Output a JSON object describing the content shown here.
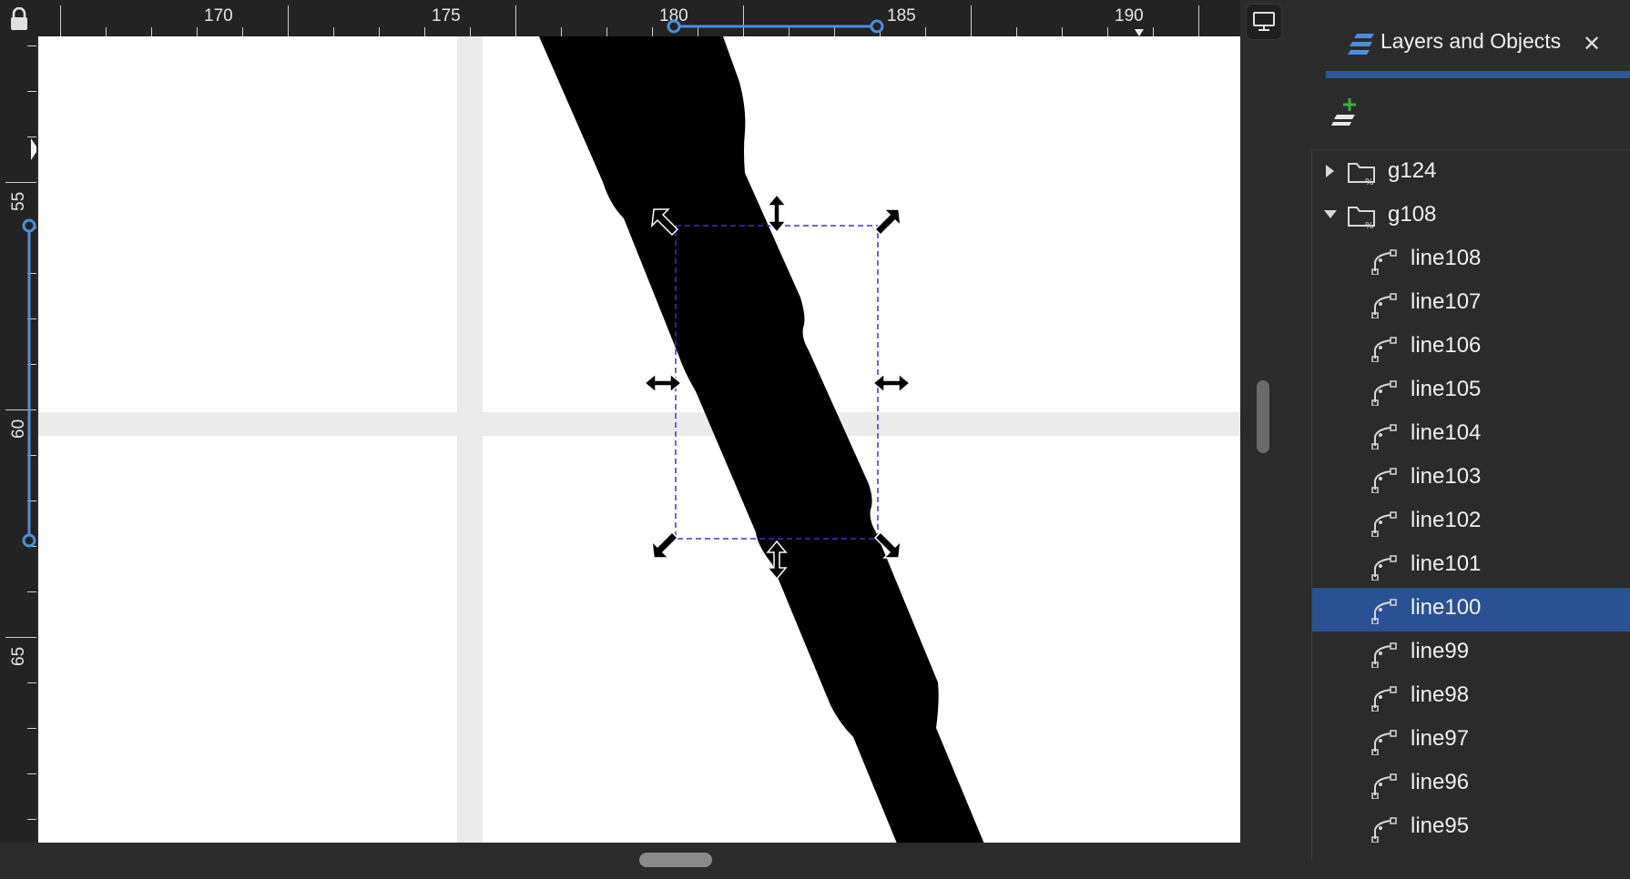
{
  "rulers": {
    "horizontal_labels": [
      "170",
      "175",
      "180",
      "185",
      "190"
    ],
    "vertical_labels": [
      "55",
      "60",
      "65"
    ]
  },
  "panel": {
    "title": "Layers and Objects",
    "close_icon": "close-icon",
    "add_layer_icon": "add-layer-icon",
    "tree": [
      {
        "name": "g124",
        "type": "group",
        "expanded": false,
        "selected": false
      },
      {
        "name": "g108",
        "type": "group",
        "expanded": true,
        "selected": false
      },
      {
        "name": "line108",
        "type": "path",
        "selected": false
      },
      {
        "name": "line107",
        "type": "path",
        "selected": false
      },
      {
        "name": "line106",
        "type": "path",
        "selected": false
      },
      {
        "name": "line105",
        "type": "path",
        "selected": false
      },
      {
        "name": "line104",
        "type": "path",
        "selected": false
      },
      {
        "name": "line103",
        "type": "path",
        "selected": false
      },
      {
        "name": "line102",
        "type": "path",
        "selected": false
      },
      {
        "name": "line101",
        "type": "path",
        "selected": false
      },
      {
        "name": "line100",
        "type": "path",
        "selected": true
      },
      {
        "name": "line99",
        "type": "path",
        "selected": false
      },
      {
        "name": "line98",
        "type": "path",
        "selected": false
      },
      {
        "name": "line97",
        "type": "path",
        "selected": false
      },
      {
        "name": "line96",
        "type": "path",
        "selected": false
      },
      {
        "name": "line95",
        "type": "path",
        "selected": false
      }
    ]
  },
  "colors": {
    "selection_highlight": "#2a5194",
    "accent": "#2c5896",
    "guide": "#4a90d9",
    "bounding_box": "#3b33c9"
  }
}
